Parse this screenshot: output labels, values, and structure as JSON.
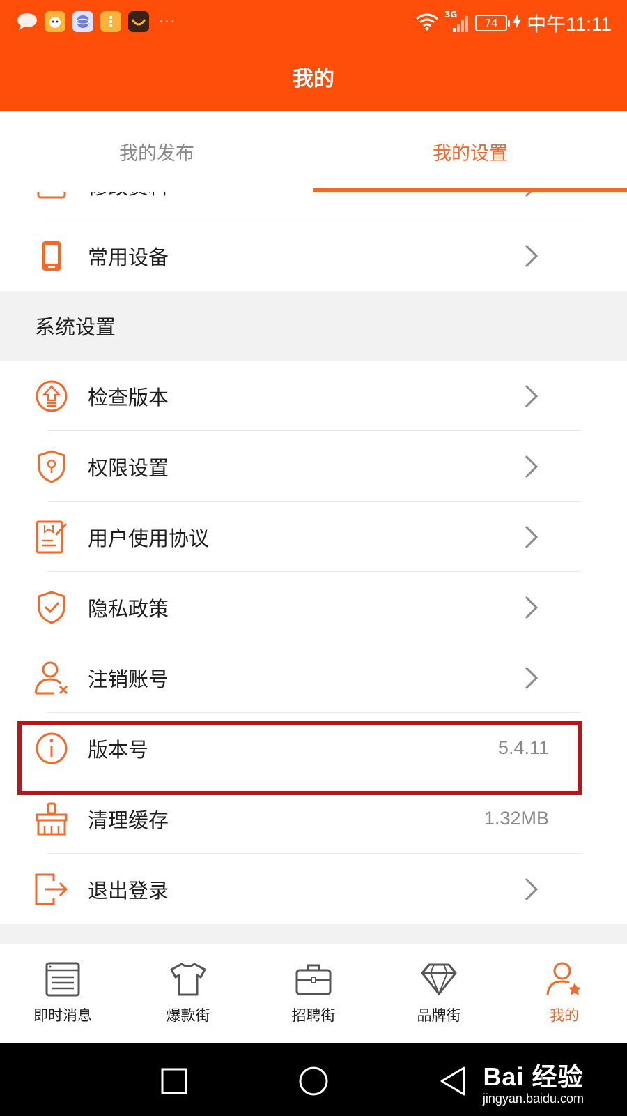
{
  "status_bar": {
    "network": "3G",
    "battery": "74",
    "time": "中午11:11",
    "more": "···"
  },
  "header": {
    "title": "我的"
  },
  "tabs": [
    {
      "label": "我的发布",
      "active": false
    },
    {
      "label": "我的设置",
      "active": true
    }
  ],
  "account_settings": {
    "items": [
      {
        "label": "修改资料",
        "icon": "edit-profile-icon"
      },
      {
        "label": "常用设备",
        "icon": "phone-icon"
      }
    ]
  },
  "system_settings": {
    "title": "系统设置",
    "items": [
      {
        "label": "检查版本",
        "icon": "upgrade-icon"
      },
      {
        "label": "权限设置",
        "icon": "shield-key-icon"
      },
      {
        "label": "用户使用协议",
        "icon": "agreement-icon"
      },
      {
        "label": "隐私政策",
        "icon": "shield-check-icon"
      },
      {
        "label": "注销账号",
        "icon": "user-remove-icon"
      },
      {
        "label": "版本号",
        "icon": "info-icon",
        "value": "5.4.11"
      },
      {
        "label": "清理缓存",
        "icon": "broom-icon",
        "value": "1.32MB"
      },
      {
        "label": "退出登录",
        "icon": "logout-icon"
      }
    ]
  },
  "bottom_nav": [
    {
      "label": "即时消息",
      "icon": "message-board-icon",
      "active": false
    },
    {
      "label": "爆款街",
      "icon": "tshirt-icon",
      "active": false
    },
    {
      "label": "招聘街",
      "icon": "briefcase-icon",
      "active": false
    },
    {
      "label": "品牌街",
      "icon": "diamond-icon",
      "active": false
    },
    {
      "label": "我的",
      "icon": "user-star-icon",
      "active": true
    }
  ],
  "watermark": {
    "logo": "Bai 经验",
    "url": "jingyan.baidu.com"
  },
  "colors": {
    "brand": "#ff4e0a",
    "accent": "#f06a2b",
    "highlight": "#b9161b"
  }
}
